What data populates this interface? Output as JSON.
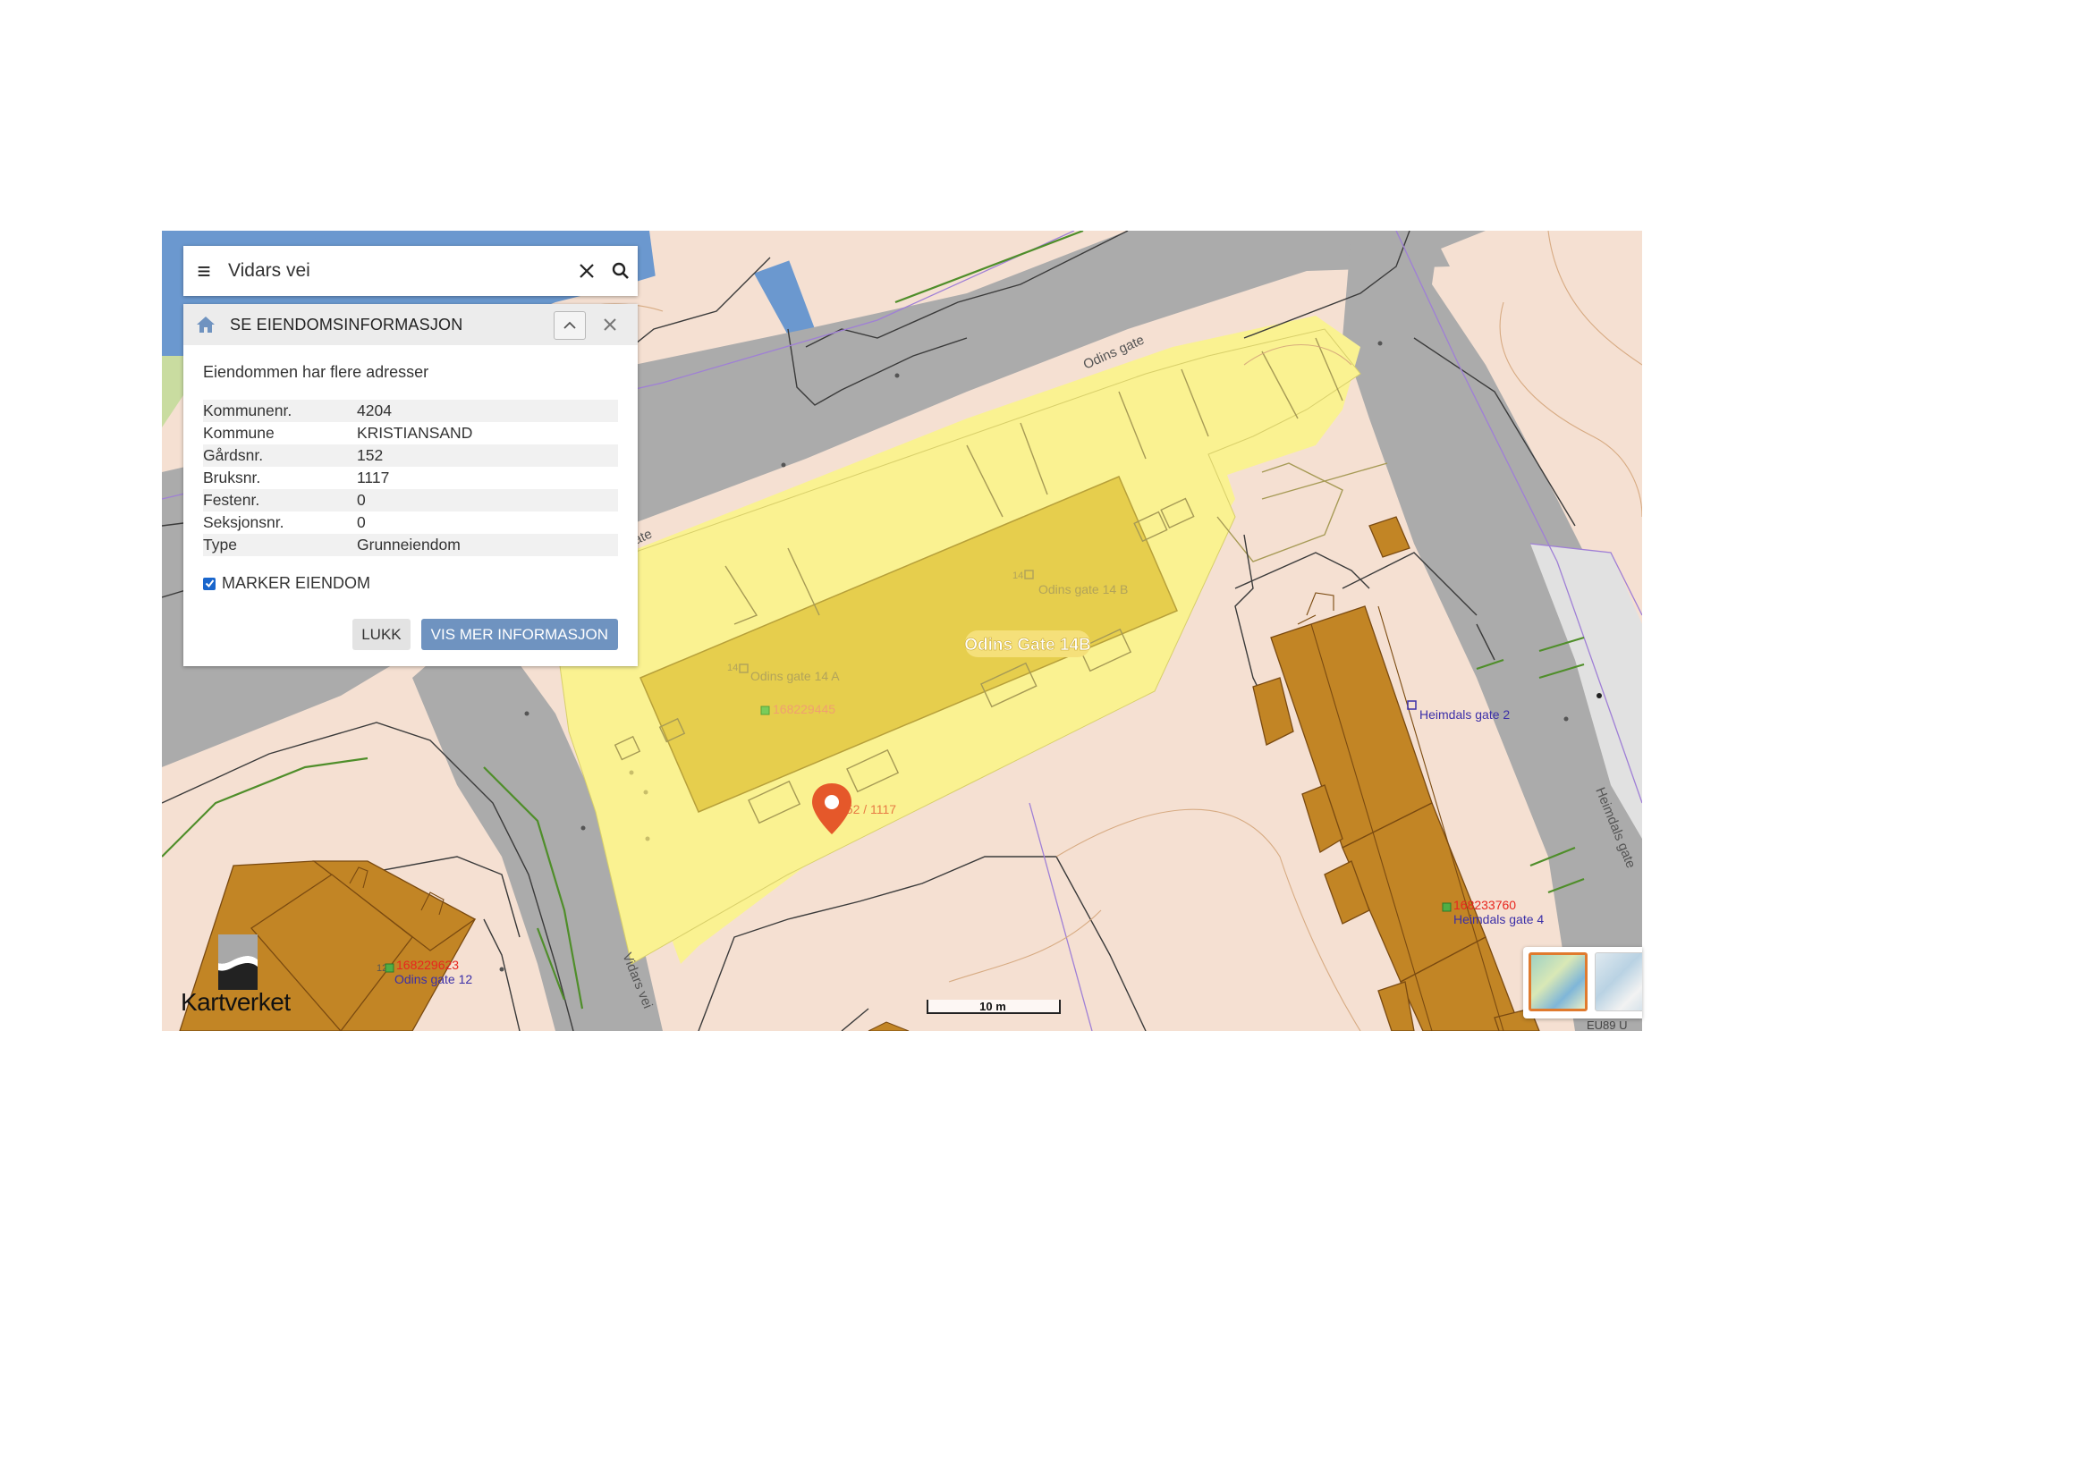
{
  "search": {
    "value": "Vidars vei",
    "menu_icon": "hamburger-menu-icon",
    "clear_icon": "close-icon",
    "search_icon": "search-icon"
  },
  "panel": {
    "title": "SE EIENDOMSINFORMASJON",
    "intro": "Eiendommen har flere adresser",
    "rows": [
      {
        "label": "Kommunenr.",
        "value": "4204"
      },
      {
        "label": "Kommune",
        "value": "KRISTIANSAND"
      },
      {
        "label": "Gårdsnr.",
        "value": "152"
      },
      {
        "label": "Bruksnr.",
        "value": "1117"
      },
      {
        "label": "Festenr.",
        "value": "0"
      },
      {
        "label": "Seksjonsnr.",
        "value": "0"
      },
      {
        "label": "Type",
        "value": "Grunneiendom"
      }
    ],
    "checkbox_label": "MARKER EIENDOM",
    "checkbox_checked": true,
    "close_button": "LUKK",
    "more_button": "VIS MER INFORMASJON"
  },
  "map": {
    "street_labels": {
      "odins_gate": "Odins gate",
      "odins_gate_partial": "ate",
      "vidars_vei": "Vidars vei",
      "heimdals_gate": "Heimdals gate"
    },
    "address_highlight": "Odins Gate 14B",
    "addresses": {
      "odins_14a": "Odins gate 14 A",
      "odins_14b": "Odins gate 14 B",
      "odins_12": "Odins gate 12",
      "heimdals_2": "Heimdals gate 2",
      "heimdals_4": "Heimdals gate 4"
    },
    "house_numbers": {
      "n14a": "14",
      "n14b": "14",
      "n12": "12"
    },
    "building_ids": {
      "b1": "168229445",
      "b2": "168229623",
      "b3": "168233760"
    },
    "parcel_label": "152 / 1117",
    "scale_label": "10 m",
    "projection_label": "EU89 U"
  },
  "brand": {
    "name": "Kartverket"
  },
  "colors": {
    "accent_button": "#6f93c0",
    "parcel_fill": "#faf291",
    "building": "#c28525",
    "road": "#ababab",
    "marker": "#e5582a"
  }
}
